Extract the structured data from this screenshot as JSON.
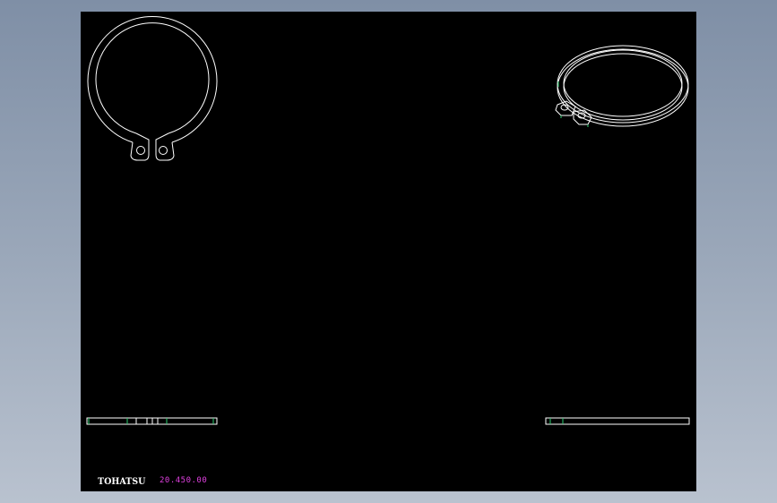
{
  "title_block": {
    "brand": "TOHATSU",
    "part_number": "20.450.00"
  },
  "colors": {
    "background": "#000000",
    "outline": "#ffffff",
    "hidden_edge": "#2ecc71",
    "part_number": "#e040e0"
  },
  "views": [
    "front-view",
    "isometric-view",
    "side-view-left",
    "side-view-right"
  ]
}
